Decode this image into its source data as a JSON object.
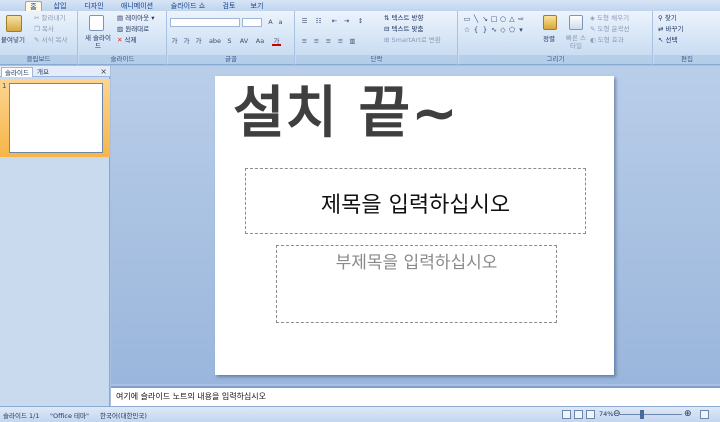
{
  "tabs": [
    "홈",
    "삽입",
    "디자인",
    "애니메이션",
    "슬라이드 쇼",
    "검토",
    "보기"
  ],
  "ribbon": {
    "clipboard": {
      "label": "클립보드",
      "paste": "붙여넣기",
      "cut": "잘라내기",
      "copy": "복사",
      "format_painter": "서식 복사"
    },
    "slides": {
      "label": "슬라이드",
      "new_slide": "새 슬라이드",
      "layout": "레이아웃",
      "reset": "원래대로",
      "delete": "삭제"
    },
    "font": {
      "label": "글꼴",
      "font_name": "",
      "font_size": "",
      "buttons": [
        "가",
        "가",
        "가",
        "abe",
        "S",
        "AV",
        "Aa",
        "가"
      ]
    },
    "paragraph": {
      "label": "단락",
      "text_direction": "텍스트 방향",
      "text_align": "텍스트 맞춤",
      "smartart": "SmartArt로 변환"
    },
    "drawing": {
      "label": "그리기",
      "arrange": "정렬",
      "quick_styles": "빠른 스타일",
      "shape_fill": "도형 채우기",
      "shape_outline": "도형 윤곽선",
      "shape_effects": "도형 효과"
    },
    "editing": {
      "label": "편집",
      "find": "찾기",
      "replace": "바꾸기",
      "select": "선택"
    }
  },
  "left_pane": {
    "tabs": [
      "슬라이드",
      "개요"
    ],
    "close": "×",
    "slide_number": "1"
  },
  "slide": {
    "big_text": "설치 끝~",
    "title_placeholder": "제목을 입력하십시오",
    "subtitle_placeholder": "부제목을 입력하십시오"
  },
  "notes": {
    "placeholder": "여기에 슬라이드 노트의 내용을 입력하십시오"
  },
  "status": {
    "slide_info": "슬라이드 1/1",
    "theme": "\"Office 테마\"",
    "language": "한국어(대한민국)",
    "zoom": "74%",
    "zoom_value": 0.74
  }
}
